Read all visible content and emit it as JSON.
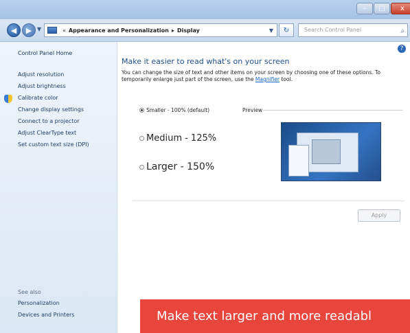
{
  "window": {
    "controls": {
      "minimize": "–",
      "maximize": "□",
      "close": "x"
    }
  },
  "nav": {
    "back_icon": "◀",
    "forward_icon": "▶",
    "address_segments": [
      "Appearance and Personalization",
      "Display"
    ],
    "address_separator": "▸",
    "address_prefix": "«",
    "refresh_icon": "↻",
    "search_placeholder": "Search Control Panel",
    "search_icon": "⌕"
  },
  "sidebar": {
    "home": "Control Panel Home",
    "items": [
      "Adjust resolution",
      "Adjust brightness",
      "Calibrate color",
      "Change display settings",
      "Connect to a projector",
      "Adjust ClearType text",
      "Set custom text size (DPI)"
    ],
    "see_also_label": "See also",
    "see_also_items": [
      "Personalization",
      "Devices and Printers"
    ]
  },
  "main": {
    "help_icon": "?",
    "title": "Make it easier to read what's on your screen",
    "description_part1": "You can change the size of text and other items on your screen by choosing one of these options. To temporarily enlarge just part of the screen, use the ",
    "description_link": "Magnifier",
    "description_part2": " tool.",
    "options": [
      {
        "label": "Smaller - 100% (default)",
        "selected": true
      },
      {
        "label": "Medium - 125%",
        "selected": false
      },
      {
        "label": "Larger - 150%",
        "selected": false
      }
    ],
    "preview_label": "Preview",
    "apply_label": "Apply"
  },
  "banner": {
    "text": "Make text larger and more readabl",
    "color": "#e8453c"
  }
}
